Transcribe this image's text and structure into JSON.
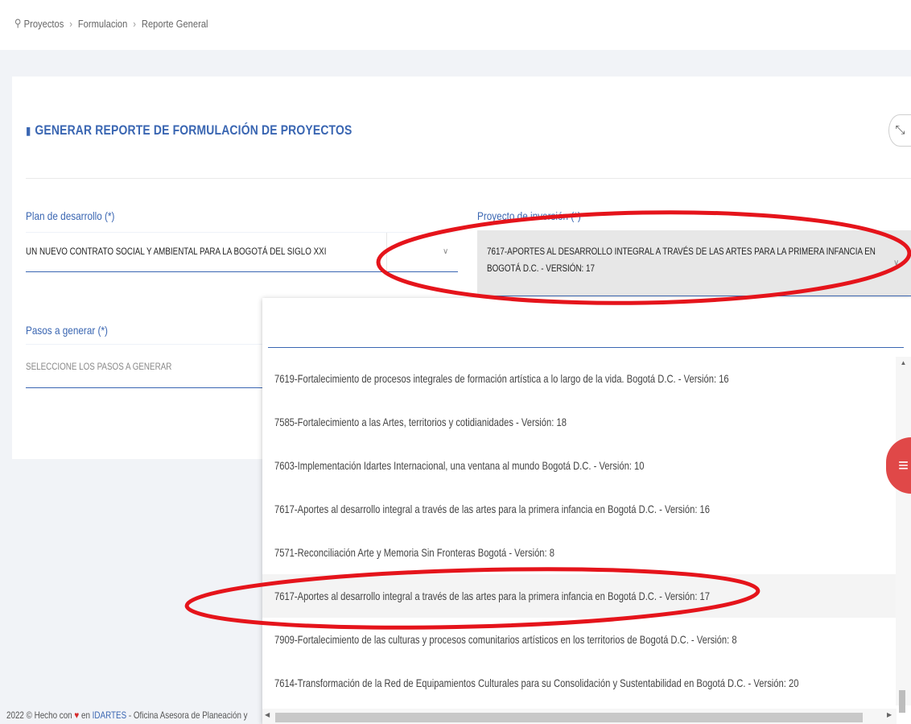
{
  "breadcrumb": {
    "items": [
      "Proyectos",
      "Formulacion",
      "Reporte General"
    ],
    "separator": "›",
    "icon": "sitemap-icon"
  },
  "card": {
    "title": "GENERAR REPORTE DE FORMULACIÓN DE PROYECTOS",
    "title_icon": "book-icon",
    "expand_icon": "expand-icon"
  },
  "form": {
    "plan_label": "Plan de desarrollo (*)",
    "plan_value": "UN NUEVO CONTRATO SOCIAL Y AMBIENTAL PARA LA BOGOTÁ DEL SIGLO XXI",
    "proyecto_label": "Proyecto de inversión (*)",
    "proyecto_value": "7617-APORTES AL DESARROLLO INTEGRAL A TRAVÉS DE LAS ARTES PARA LA PRIMERA INFANCIA EN BOGOTÁ D.C. - VERSIÓN: 17",
    "pasos_label": "Pasos a generar (*)",
    "pasos_placeholder": "SELECCIONE LOS PASOS A GENERAR"
  },
  "dropdown": {
    "search_value": "",
    "options": [
      "7619-Fortalecimiento de procesos integrales de formación artística a lo largo de la vida. Bogotá D.C. - Versión: 16",
      "7585-Fortalecimiento a las Artes, territorios y cotidianidades - Versión: 18",
      "7603-Implementación Idartes Internacional, una ventana al mundo Bogotá D.C. - Versión: 10",
      "7617-Aportes al desarrollo integral a través de las artes para la primera infancia en Bogotá D.C. - Versión: 16",
      "7571-Reconciliación Arte y Memoria Sin Fronteras Bogotá - Versión: 8",
      "7617-Aportes al desarrollo integral a través de las artes para la primera infancia en Bogotá D.C. - Versión: 17",
      "7909-Fortalecimiento de las culturas y procesos comunitarios artísticos en los territorios de Bogotá D.C. - Versión: 8",
      "7614-Transformación de la Red de Equipamientos Culturales para su Consolidación y Sustentabilidad en Bogotá D.C. - Versión: 20"
    ],
    "highlighted_index": 5
  },
  "footer": {
    "prefix": "2022 © Hecho con",
    "middle": "en",
    "link": "IDARTES",
    "suffix": "- Oficina Asesora de Planeación y"
  },
  "fab": {
    "icon": "menu-icon"
  },
  "colors": {
    "accent": "#3a66b2",
    "annotation": "#e5141b",
    "fab": "#e04848"
  }
}
